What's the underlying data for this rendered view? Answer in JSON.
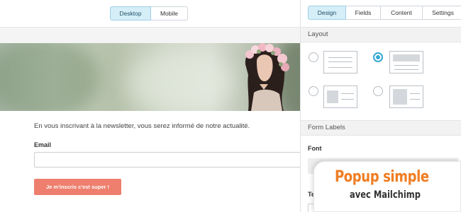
{
  "preview": {
    "view_toggle": {
      "desktop": "Desktop",
      "mobile": "Mobile",
      "active": "Desktop"
    },
    "intro_text": "En vous inscrivant à la newsletter, vous serez informé de notre actualité.",
    "email_label": "Email",
    "email_value": "",
    "submit_label": "Je m'inscris c'est super !",
    "colors": {
      "submit": "#ee7f6e",
      "active_tab": "#d5eef8"
    }
  },
  "panel": {
    "tabs": [
      {
        "label": "Design",
        "active": true
      },
      {
        "label": "Fields",
        "active": false
      },
      {
        "label": "Content",
        "active": false
      },
      {
        "label": "Settings",
        "active": false
      }
    ],
    "layout_section": "Layout",
    "layout_options": [
      "layout-stacked-text",
      "layout-image-top",
      "layout-image-left",
      "layout-image-left-large"
    ],
    "selected_layout": "layout-image-top",
    "form_labels_section": "Form Labels",
    "font_label": "Font",
    "font_value": "",
    "next_label_partial": "Te"
  },
  "badge": {
    "title": "Popup simple",
    "subtitle": "avec Mailchimp",
    "title_color": "#f07d22"
  }
}
